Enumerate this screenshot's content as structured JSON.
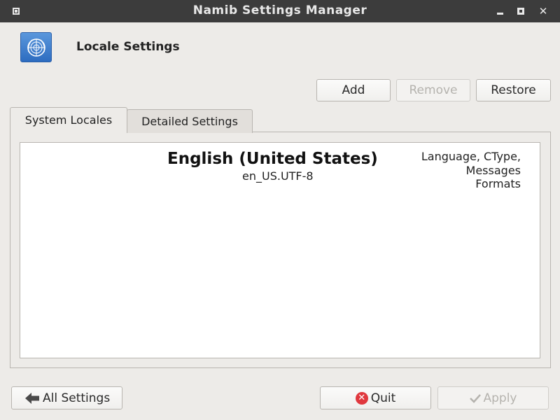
{
  "window": {
    "title": "Namib Settings Manager"
  },
  "header": {
    "title": "Locale Settings",
    "icon": "un-globe-icon"
  },
  "toolbar": {
    "add_label": "Add",
    "remove_label": "Remove",
    "restore_label": "Restore"
  },
  "tabs": [
    {
      "label": "System Locales",
      "active": true
    },
    {
      "label": "Detailed Settings",
      "active": false
    }
  ],
  "locales": [
    {
      "name": "English (United States)",
      "code": "en_US.UTF-8",
      "categories_line1": "Language, CType,",
      "categories_line2": "Messages",
      "categories_line3": "Formats"
    }
  ],
  "footer": {
    "all_settings_label": "All Settings",
    "quit_label": "Quit",
    "apply_label": "Apply"
  },
  "colors": {
    "titlebar": "#3c3c3c",
    "window_bg": "#edebe8",
    "quit_icon": "#e0383e",
    "header_icon": "#3f7fd0"
  }
}
